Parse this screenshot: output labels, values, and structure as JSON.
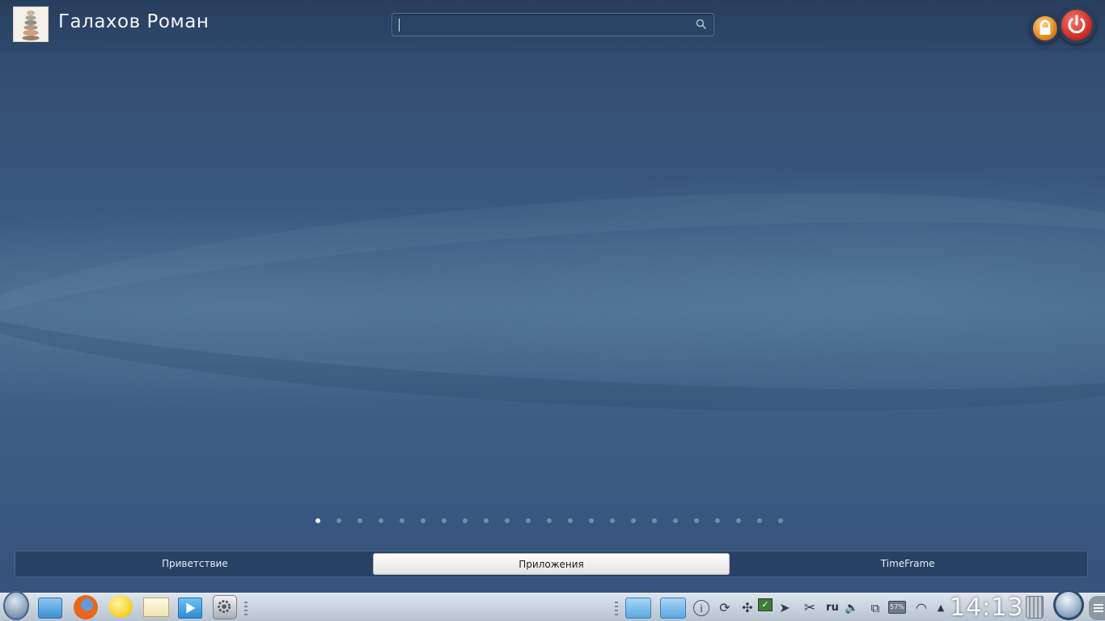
{
  "header": {
    "user_name": "Галахов Роман",
    "search": {
      "value": "",
      "placeholder": ""
    },
    "lock_icon": "lock-icon",
    "power_icon": "power-icon"
  },
  "pager": {
    "count": 23,
    "active_index": 0
  },
  "tabs": [
    {
      "label": "Приветствие",
      "active": false
    },
    {
      "label": "Приложения",
      "active": true
    },
    {
      "label": "TimeFrame",
      "active": false
    }
  ],
  "taskbar": {
    "launchers": [
      "launcher-orb-icon",
      "file-manager-icon",
      "firefox-icon",
      "chat-icon",
      "mail-icon",
      "media-player-icon",
      "system-settings-icon"
    ],
    "tray": {
      "info_glyph": "i",
      "lang": "ru",
      "battery": "57%",
      "clock": "14:13"
    }
  },
  "colors": {
    "wallpaper": "#3a5a80",
    "lock_button": "#e68a1e",
    "power_button": "#d32f2a",
    "active_tab": "#ffffff"
  }
}
